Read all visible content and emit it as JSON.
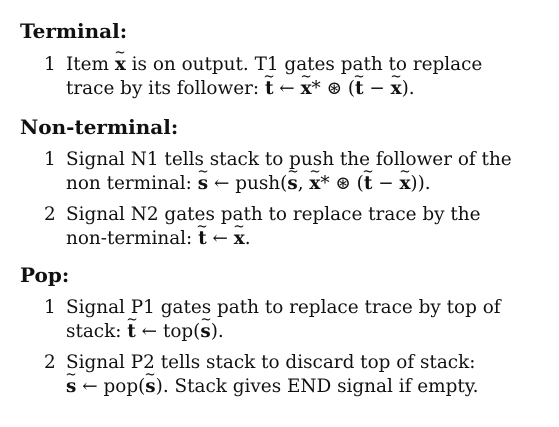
{
  "sections": [
    {
      "heading": "Terminal:",
      "items": [
        {
          "num": "1",
          "line1_text": "Item",
          "line1_sym": "x",
          "line1_rest": "is on output. T1 gates path to replace",
          "line2_text": "trace by its follower:",
          "line2_math_a": "t",
          "line2_arrow": "←",
          "line2_math_b": "x",
          "line2_math_c": "* ⊛ (",
          "line2_math_d": "t",
          "line2_math_e": " − ",
          "line2_math_f": "x",
          "line2_math_g": ")."
        }
      ]
    },
    {
      "heading": "Non-terminal:",
      "items": [
        {
          "num": "1",
          "line1": "Signal N1 tells stack to push the follower of the",
          "line2_text": "non terminal:",
          "line2_s1": "s",
          "line2_arrow": "←",
          "line2_push": "push(",
          "line2_s2": "s",
          "line2_comma": ", ",
          "line2_x1": "x",
          "line2_star": "* ⊛ (",
          "line2_t": "t",
          "line2_minus": " − ",
          "line2_x2": "x",
          "line2_end": "))."
        },
        {
          "num": "2",
          "line1": "Signal N2 gates path to replace trace by the",
          "line2_text": "non-terminal:",
          "line2_t": "t",
          "line2_arrow": "←",
          "line2_x": "x",
          "line2_end": "."
        }
      ]
    },
    {
      "heading": "Pop:",
      "items": [
        {
          "num": "1",
          "line1": "Signal P1 gates path to replace trace by top of",
          "line2_text": "stack:",
          "line2_t": "t",
          "line2_arrow": "←",
          "line2_top": "top(",
          "line2_s": "s",
          "line2_end": ")."
        },
        {
          "num": "2",
          "line1": "Signal P2 tells stack to discard top of stack:",
          "line2_s1": "s",
          "line2_arrow": "←",
          "line2_pop": "pop(",
          "line2_s2": "s",
          "line2_end": "). Stack gives END signal if empty."
        }
      ]
    }
  ]
}
